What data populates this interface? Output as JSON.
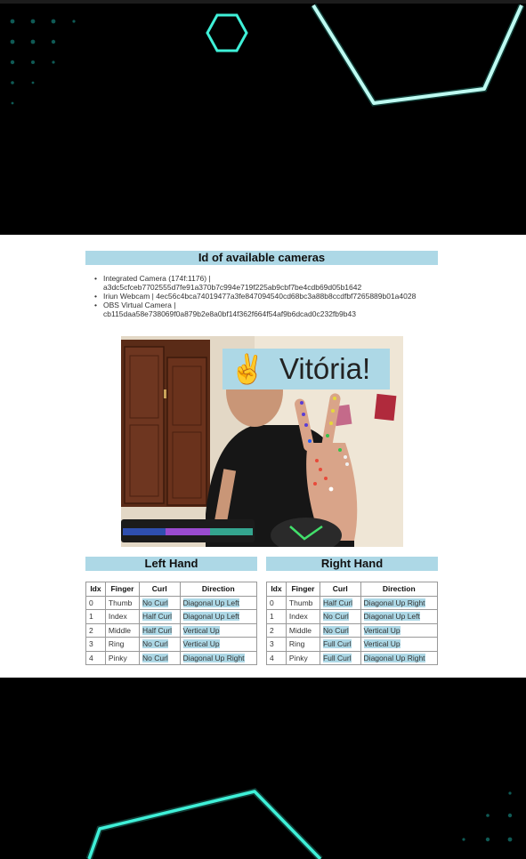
{
  "page": {
    "title": "Id of available cameras",
    "cameras": [
      {
        "label": "Integrated Camera (174f:1176) |",
        "id": "a3dc5cfceb7702555d7fe91a370b7c994e719f225ab9cbf7be4cdb69d05b1642"
      },
      {
        "label": "Iriun Webcam | 4ec56c4bca74019477a3fe847094540cd68bc3a88b8ccdfbf7265889b01a4028",
        "id": ""
      },
      {
        "label": "OBS Virtual Camera |",
        "id": "cb115daa58e738069f0a879b2e8a0bf14f362f664f54af9b6dcad0c232fb9b43"
      }
    ],
    "video": {
      "overlay_emoji": "✌️",
      "overlay_text": "Vitória!"
    },
    "tables": {
      "columns": [
        "Idx",
        "Finger",
        "Curl",
        "Direction"
      ],
      "left": {
        "title": "Left Hand",
        "rows": [
          [
            "0",
            "Thumb",
            "No Curl",
            "Diagonal Up Left"
          ],
          [
            "1",
            "Index",
            "Half Curl",
            "Diagonal Up Left"
          ],
          [
            "2",
            "Middle",
            "Half Curl",
            "Vertical Up"
          ],
          [
            "3",
            "Ring",
            "No Curl",
            "Vertical Up"
          ],
          [
            "4",
            "Pinky",
            "No Curl",
            "Diagonal Up Right"
          ]
        ]
      },
      "right": {
        "title": "Right Hand",
        "rows": [
          [
            "0",
            "Thumb",
            "Half Curl",
            "Diagonal Up Right"
          ],
          [
            "1",
            "Index",
            "No Curl",
            "Diagonal Up Left"
          ],
          [
            "2",
            "Middle",
            "No Curl",
            "Vertical Up"
          ],
          [
            "3",
            "Ring",
            "Full Curl",
            "Vertical Up"
          ],
          [
            "4",
            "Pinky",
            "Full Curl",
            "Diagonal Up Right"
          ]
        ]
      }
    }
  },
  "colors": {
    "accent": "#add8e6",
    "background": "#000000",
    "neon": "#3ff0d8"
  }
}
